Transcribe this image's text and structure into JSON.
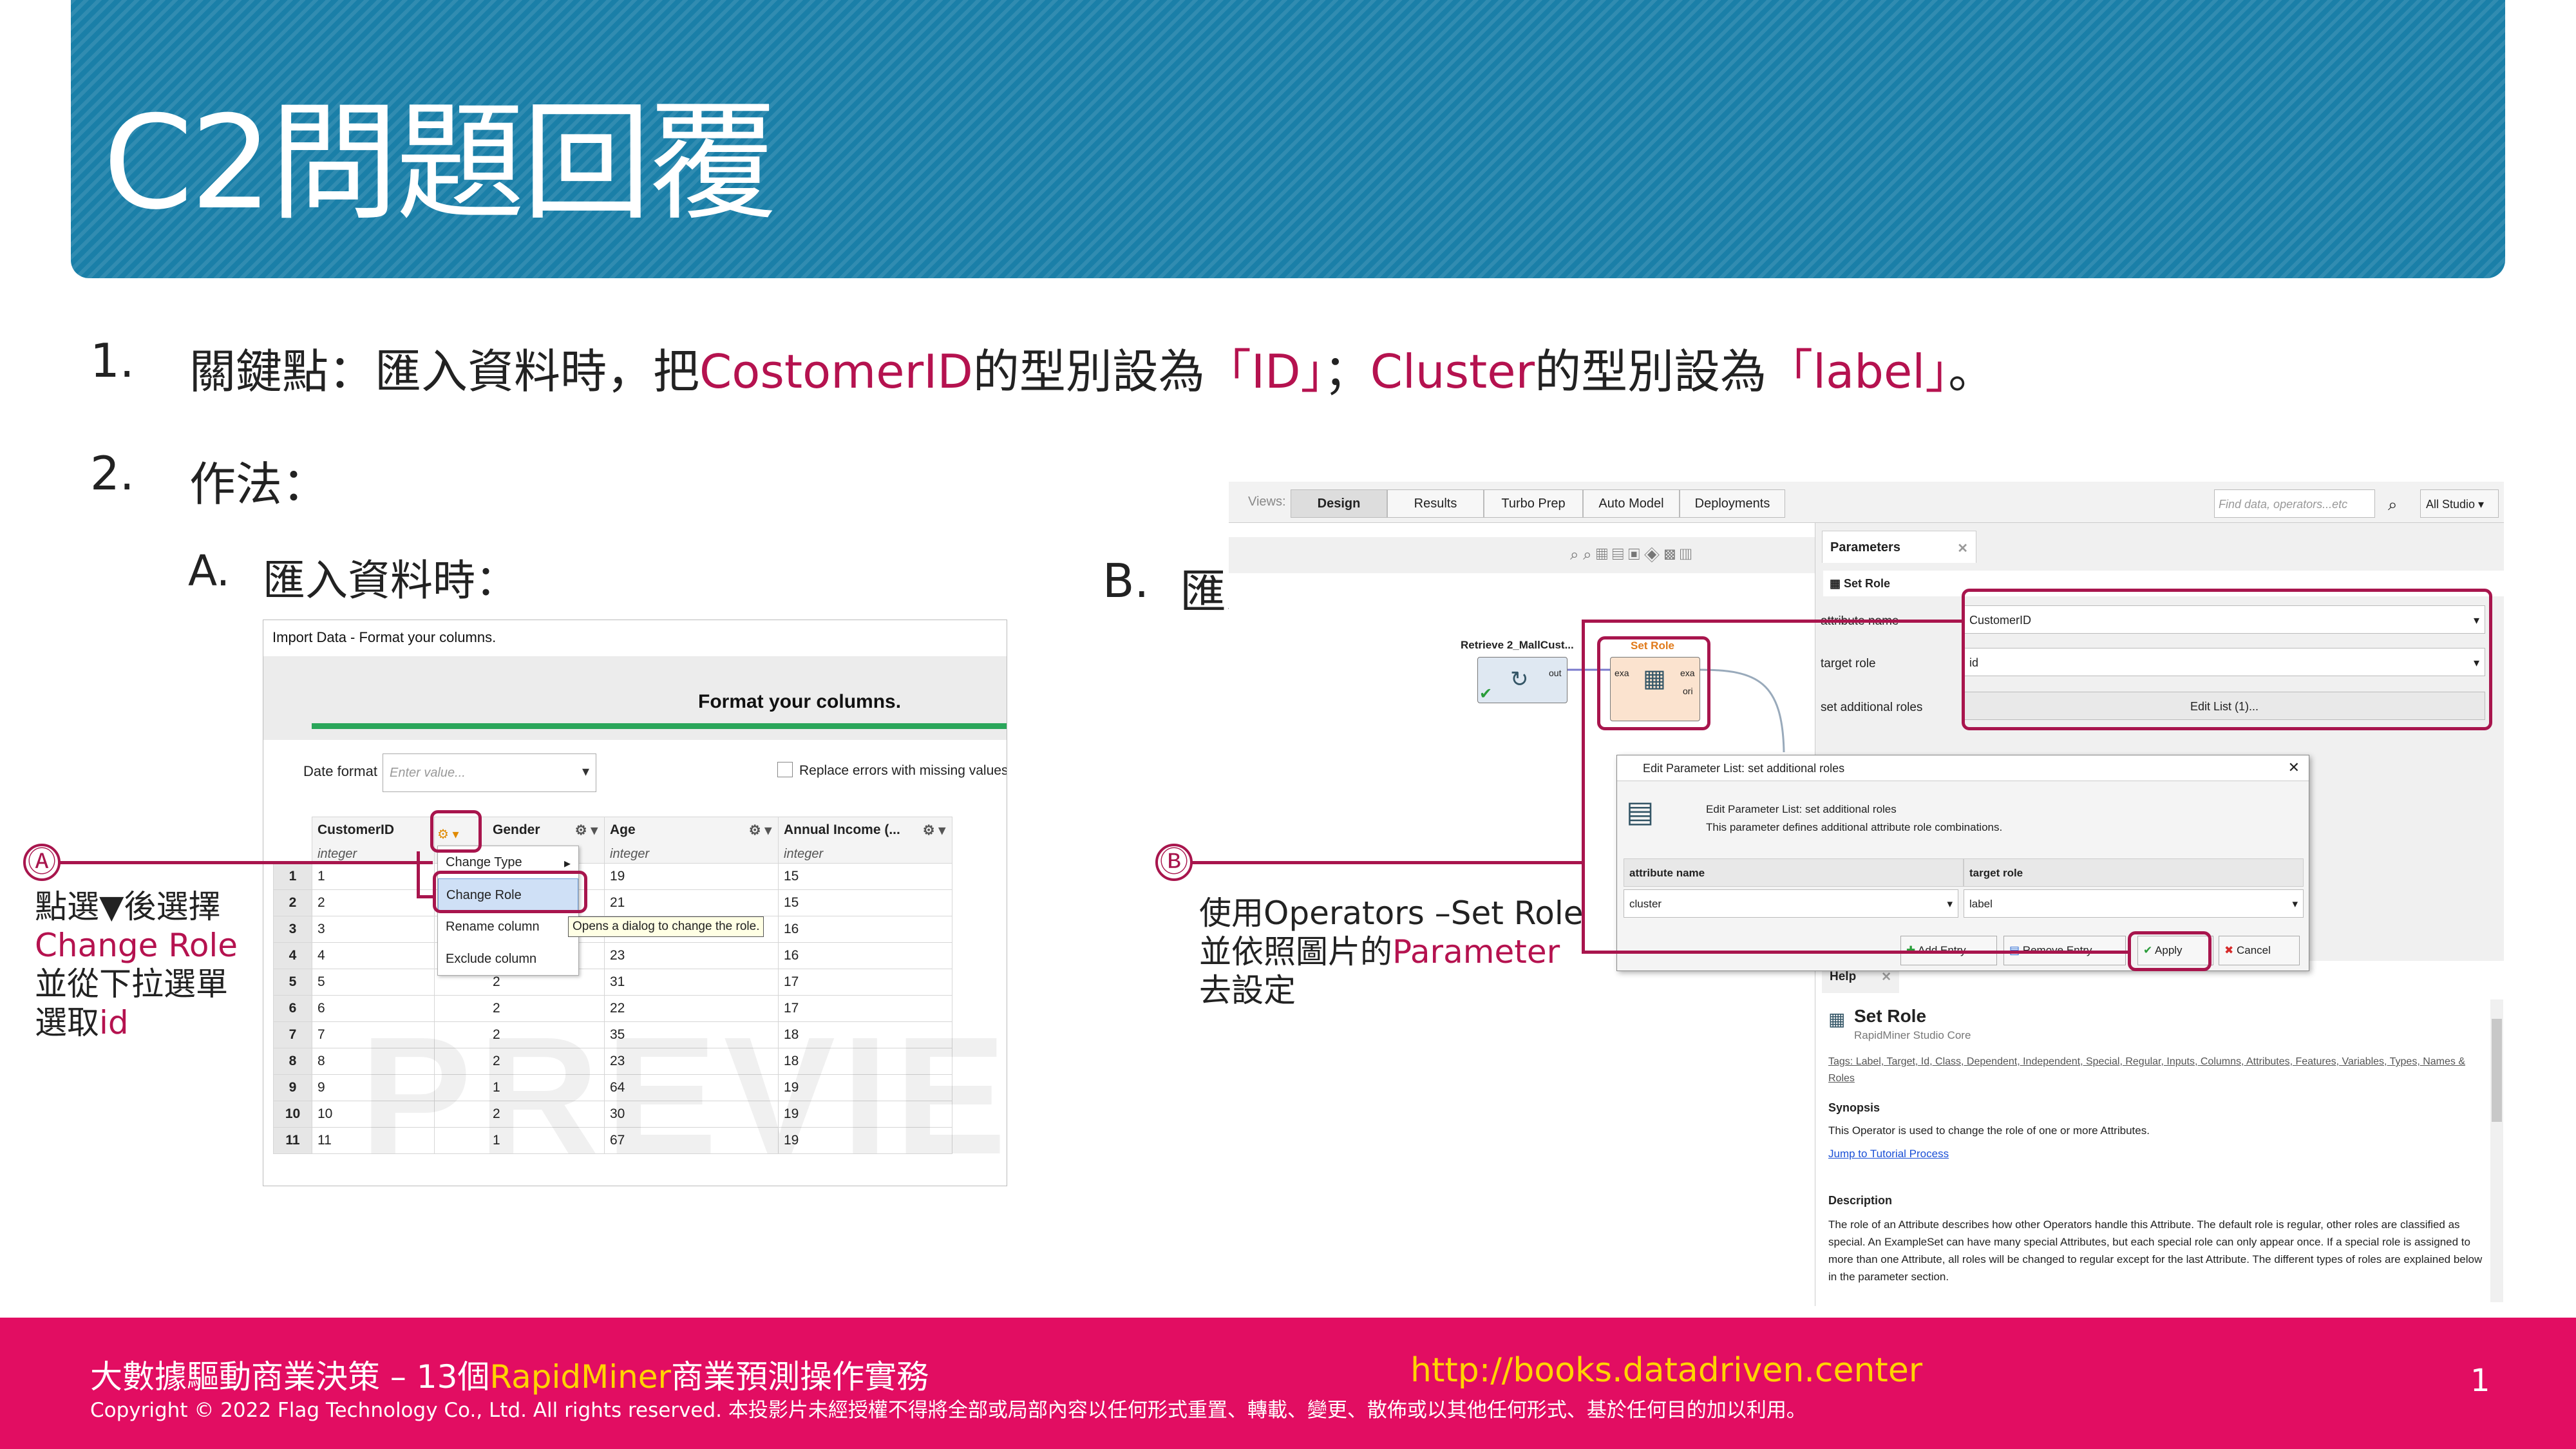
{
  "slide": {
    "title": "C2問題回覆",
    "page_number": "1"
  },
  "point1": {
    "number": "1.",
    "text_a": "關鍵點：匯入資料時，把",
    "hl_a": "CostomerID",
    "text_b": "的型別設為",
    "hl_b": "「ID」",
    "text_c": "；",
    "hl_c": "Cluster",
    "text_d": "的型別設為",
    "hl_d": "「label」",
    "text_e": "。"
  },
  "point2": {
    "number": "2.",
    "text": "作法："
  },
  "section_a": {
    "label": "A.",
    "text": "匯入資料時："
  },
  "section_b": {
    "label": "B.",
    "text": "匯入後修改："
  },
  "callout_a": {
    "marker": "Ⓐ",
    "line1": "點選▼後選擇",
    "line2": "Change Role",
    "line3": "並從下拉選單",
    "line4a": "選取",
    "line4b": "id"
  },
  "callout_b": {
    "marker": "Ⓑ",
    "line1": "使用Operators –Set Role",
    "line2a": "並依照圖片的",
    "line2b": "Parameter",
    "line3": "去設定"
  },
  "import_dialog": {
    "window_title": "Import Data - Format your columns.",
    "heading": "Format your columns.",
    "date_format_label": "Date format",
    "date_format_placeholder": "Enter value...",
    "replace_errors_label": "Replace errors with missing values",
    "columns": [
      {
        "name": "CustomerID",
        "type": "integer"
      },
      {
        "name": "Gender",
        "type": ""
      },
      {
        "name": "Age",
        "type": "integer"
      },
      {
        "name": "Annual Income (...",
        "type": "integer"
      }
    ],
    "rows": [
      [
        "1",
        "1",
        "",
        "19",
        "15"
      ],
      [
        "2",
        "2",
        "",
        "21",
        "15"
      ],
      [
        "3",
        "3",
        "",
        "20",
        "16"
      ],
      [
        "4",
        "4",
        "2",
        "23",
        "16"
      ],
      [
        "5",
        "5",
        "2",
        "31",
        "17"
      ],
      [
        "6",
        "6",
        "2",
        "22",
        "17"
      ],
      [
        "7",
        "7",
        "2",
        "35",
        "18"
      ],
      [
        "8",
        "8",
        "2",
        "23",
        "18"
      ],
      [
        "9",
        "9",
        "1",
        "64",
        "19"
      ],
      [
        "10",
        "10",
        "2",
        "30",
        "19"
      ],
      [
        "11",
        "11",
        "1",
        "67",
        "19"
      ]
    ],
    "menu_items": [
      "Change Type",
      "Change Role",
      "Rename column",
      "Exclude column"
    ],
    "tooltip": "Opens a dialog to change the role.",
    "watermark": "PREVIEW"
  },
  "studio": {
    "views_label": "Views:",
    "view_tabs": [
      "Design",
      "Results",
      "Turbo Prep",
      "Auto Model",
      "Deployments"
    ],
    "search_placeholder": "Find data, operators...etc",
    "studio_dropdown": "All Studio ▾",
    "operator_retrieve": "Retrieve 2_MallCust...",
    "operator_set_role": "Set Role",
    "port_out": "out",
    "port_exa": "exa",
    "port_ori": "ori",
    "params_tab": "Parameters",
    "params_header": "Set Role",
    "param_rows": [
      {
        "label": "attribute name",
        "value": "CustomerID"
      },
      {
        "label": "target role",
        "value": "id"
      },
      {
        "label": "set additional roles",
        "value": "Edit List (1)..."
      }
    ],
    "dialog_title": "Edit Parameter List: set additional roles",
    "dialog_heading": "Edit Parameter List: set additional roles",
    "dialog_desc": "This parameter defines additional attribute role combinations.",
    "dialog_col1": "attribute name",
    "dialog_col2": "target role",
    "dialog_val1": "cluster",
    "dialog_val2": "label",
    "btn_add": "Add Entry",
    "btn_remove": "Remove Entry",
    "btn_apply": "Apply",
    "btn_cancel": "Cancel",
    "help_tab": "Help",
    "help_title": "Set Role",
    "help_sub": "RapidMiner Studio Core",
    "help_tags": "Tags: Label, Target, Id, Class, Dependent, Independent, Special, Regular, Inputs, Columns, Attributes, Features, Variables, Types, Names & Roles",
    "synopsis_title": "Synopsis",
    "synopsis_text": "This Operator is used to change the role of one or more Attributes.",
    "tutorial_link": "Jump to Tutorial Process",
    "description_title": "Description",
    "description_text": "The role of an Attribute describes how other Operators handle this Attribute. The default role is regular, other roles are classified as special. An ExampleSet can have many special Attributes, but each special role can only appear once. If a special role is assigned to more than one Attribute, all roles will be changed to regular except for the last Attribute. The different types of roles are explained below in the parameter section."
  },
  "footer": {
    "book_a": "大數據驅動商業決策 – 13個",
    "book_b": "RapidMiner",
    "book_c": "商業預測操作實務",
    "url": "http://books.datadriven.center",
    "copyright": "Copyright © 2022 Flag Technology Co., Ltd. All rights reserved.  本投影片未經授權不得將全部或局部內容以任何形式重置、轉載、變更、散佈或以其他任何形式、基於任何目的加以利用。"
  },
  "colors": {
    "banner": "#1a7fa8",
    "footer": "#e20d62",
    "highlight": "#b5124f",
    "callout": "#a8154d",
    "footer_highlight": "#ffd400"
  }
}
